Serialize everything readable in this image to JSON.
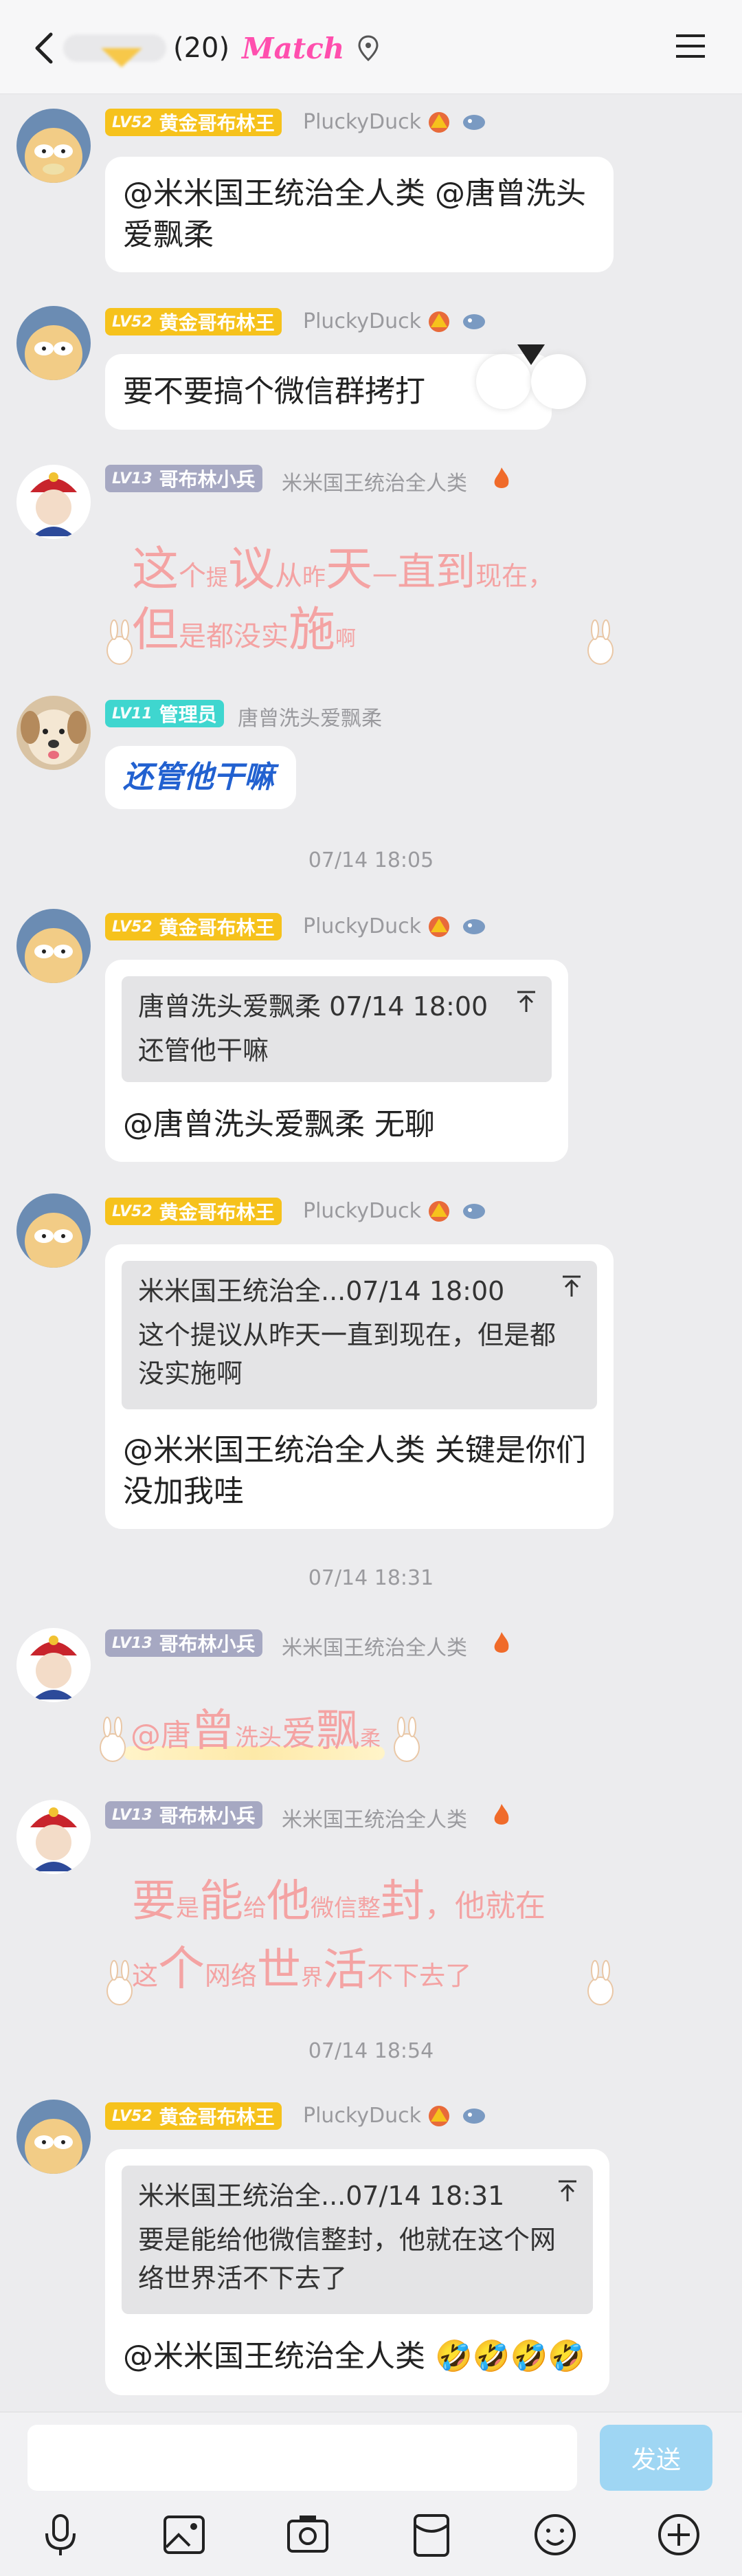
{
  "header": {
    "member_count": "(20)",
    "match_label": "Match"
  },
  "messages": [
    {
      "badge_level": "LV52",
      "badge_title": "黄金哥布林王",
      "nickname": "PluckyDuck",
      "text": "@米米国王统治全人类 @唐曾洗头\n爱飘柔"
    },
    {
      "badge_level": "LV52",
      "badge_title": "黄金哥布林王",
      "nickname": "PluckyDuck",
      "text": "要不要搞个微信群拷打"
    },
    {
      "badge_level": "LV13",
      "badge_title": "哥布林小兵",
      "nickname": "米米国王统治全人类",
      "fancy_line1": [
        "这",
        "个",
        "提",
        "议",
        "从",
        "昨",
        "天",
        "一",
        "直",
        "到",
        "现在，"
      ],
      "fancy_line2": [
        "但",
        "是都没实",
        "施",
        "啊"
      ]
    },
    {
      "badge_level": "LV11",
      "badge_title": "管理员",
      "nickname": "唐曾洗头爱飘柔",
      "text": "还管他干嘛"
    },
    {
      "time": "07/14 18:05"
    },
    {
      "badge_level": "LV52",
      "badge_title": "黄金哥布林王",
      "nickname": "PluckyDuck",
      "quote_header": "唐曾洗头爱飘柔 07/14 18:00",
      "quote_text": "还管他干嘛",
      "text": "@唐曾洗头爱飘柔 无聊"
    },
    {
      "badge_level": "LV52",
      "badge_title": "黄金哥布林王",
      "nickname": "PluckyDuck",
      "quote_header": "米米国王统治全...07/14 18:00",
      "quote_text": "这个提议从昨天一直到现在，但是都\n没实施啊",
      "text": "@米米国王统治全人类 关键是你们\n没加我哇"
    },
    {
      "time": "07/14 18:31"
    },
    {
      "badge_level": "LV13",
      "badge_title": "哥布林小兵",
      "nickname": "米米国王统治全人类",
      "fancy_line1": [
        "@唐",
        "曾",
        "洗头",
        "爱",
        "飘",
        "柔"
      ]
    },
    {
      "badge_level": "LV13",
      "badge_title": "哥布林小兵",
      "nickname": "米米国王统治全人类",
      "fancy_line1": [
        "要",
        "是",
        "能",
        "给",
        "他",
        "微信整",
        "封",
        "，他就在"
      ],
      "fancy_line2": [
        "这",
        "个",
        "网络",
        "世",
        "界",
        "活",
        "不下去了"
      ]
    },
    {
      "time": "07/14 18:54"
    },
    {
      "badge_level": "LV52",
      "badge_title": "黄金哥布林王",
      "nickname": "PluckyDuck",
      "quote_header": "米米国王统治全...07/14 18:31",
      "quote_text": "要是能给他微信整封，他就在这个网\n络世界活不下去了",
      "text": "@米米国王统治全人类 🤣🤣🤣🤣"
    }
  ],
  "input": {
    "placeholder": "",
    "send_label": "发送"
  },
  "colors": {
    "gold_badge": "#f6c21c",
    "gray_badge": "#a6a8c2",
    "admin_badge": "#3fd6cf",
    "send_button": "#9fd6f3",
    "fancy_text": "#f4a3a3"
  }
}
